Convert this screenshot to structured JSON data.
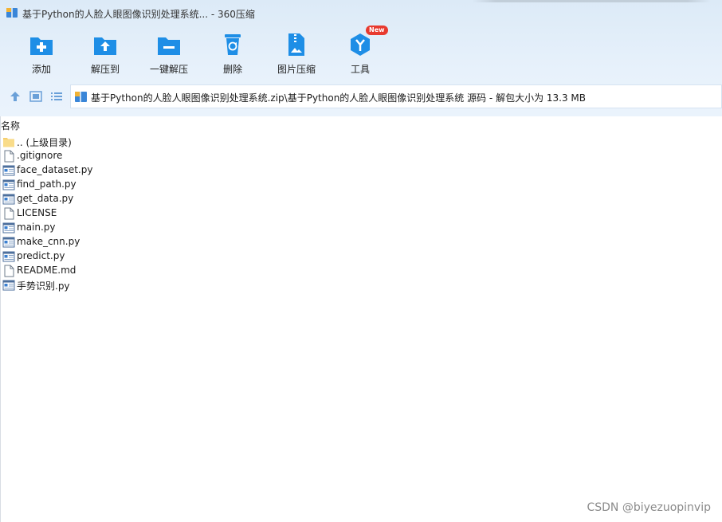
{
  "window": {
    "title": "基于Python的人脸人眼图像识别处理系统... - 360压缩"
  },
  "toolbar": {
    "add_label": "添加",
    "extract_to_label": "解压到",
    "one_click_extract_label": "一键解压",
    "delete_label": "删除",
    "image_compress_label": "图片压缩",
    "tools_label": "工具",
    "tools_badge": "New",
    "accent_color": "#1e8ee6",
    "badge_color": "#e83a2f"
  },
  "address": {
    "path": "基于Python的人脸人眼图像识别处理系统.zip\\基于Python的人脸人眼图像识别处理系统 源码 - 解包大小为 13.3 MB"
  },
  "list": {
    "column_name": "名称",
    "files": [
      {
        "name": ".. (上级目录)",
        "icon": "folder-icon"
      },
      {
        "name": ".gitignore",
        "icon": "document-icon"
      },
      {
        "name": "face_dataset.py",
        "icon": "python-file-icon"
      },
      {
        "name": "find_path.py",
        "icon": "python-file-icon"
      },
      {
        "name": "get_data.py",
        "icon": "python-file-icon"
      },
      {
        "name": "LICENSE",
        "icon": "document-icon"
      },
      {
        "name": "main.py",
        "icon": "python-file-icon"
      },
      {
        "name": "make_cnn.py",
        "icon": "python-file-icon"
      },
      {
        "name": "predict.py",
        "icon": "python-file-icon"
      },
      {
        "name": "README.md",
        "icon": "document-icon"
      },
      {
        "name": "手势识别.py",
        "icon": "python-file-icon"
      }
    ]
  },
  "watermark": "CSDN @biyezuopinvip"
}
